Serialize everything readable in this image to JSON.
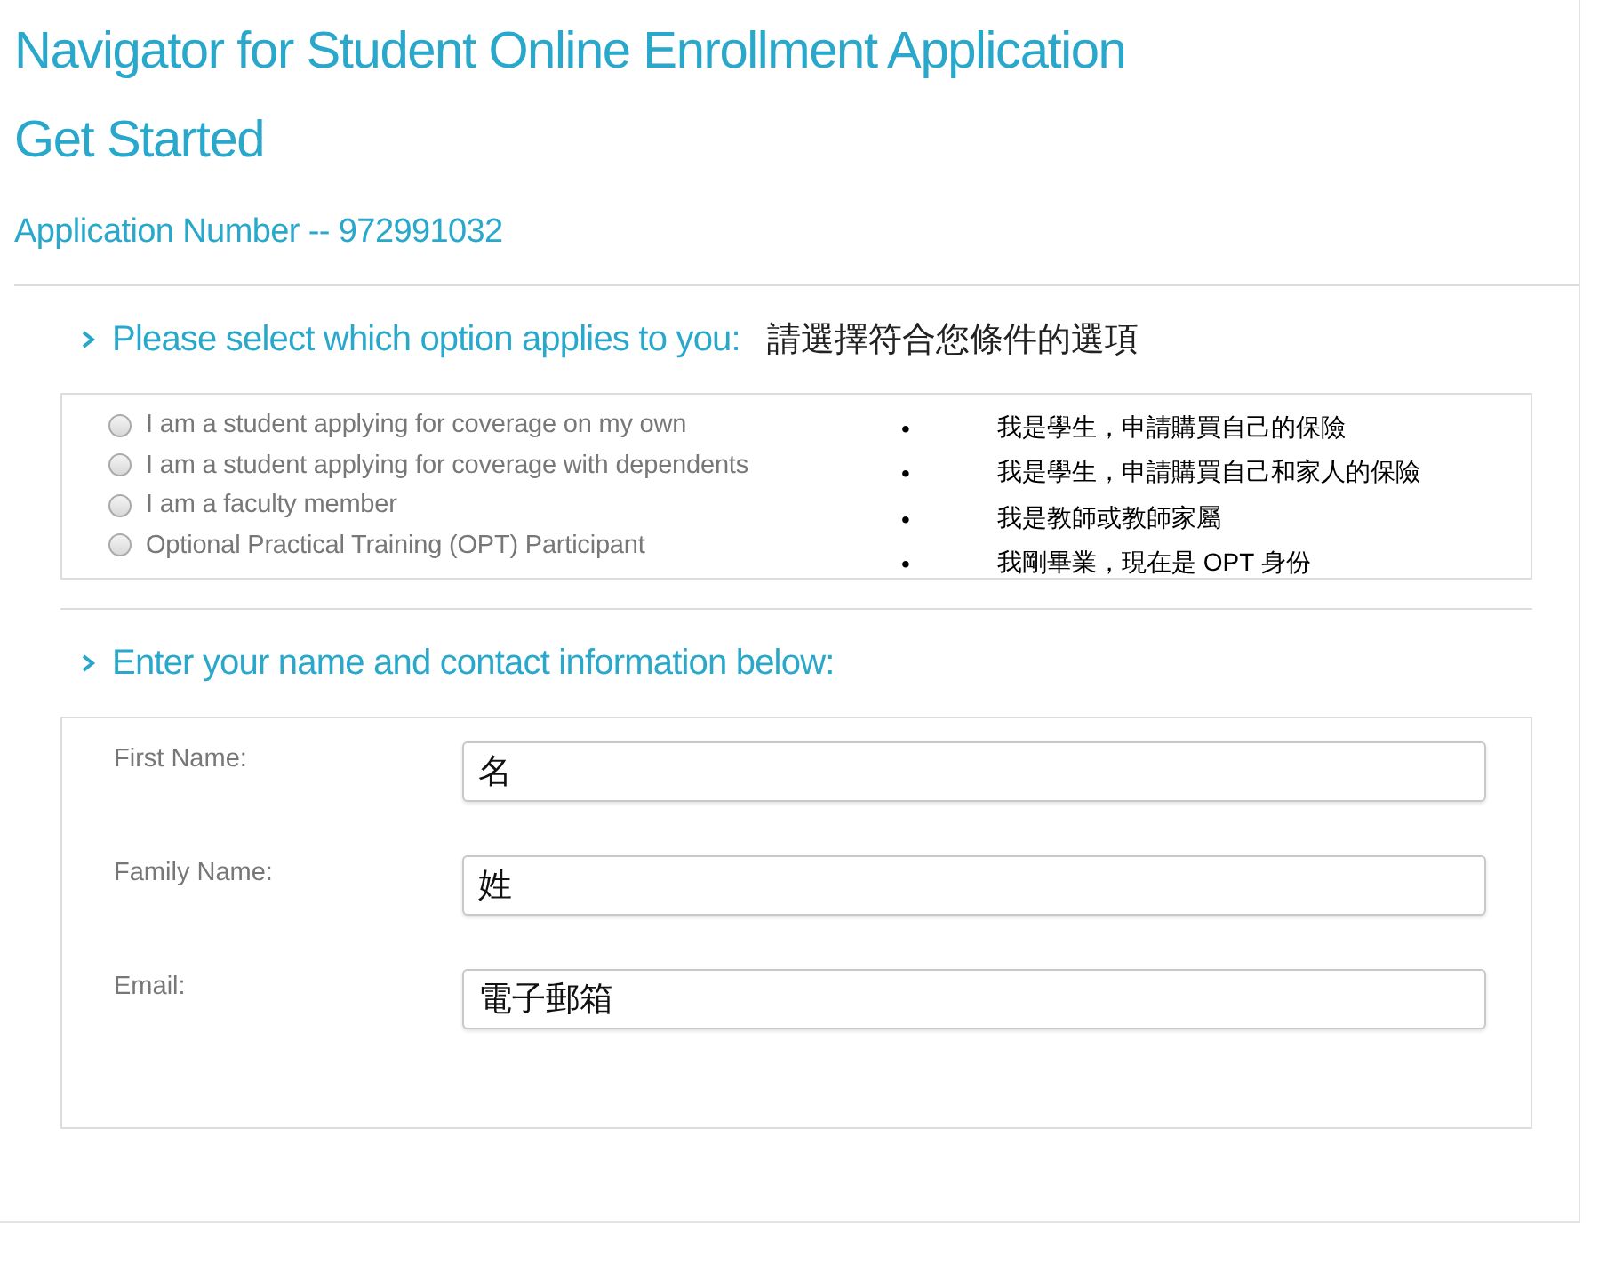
{
  "title_lines": [
    "Navigator for Student Online Enrollment Application",
    "Get Started"
  ],
  "application_number": "Application Number -- 972991032",
  "option_section": {
    "heading": "Please select which option applies to you:",
    "heading_translation": "請選擇符合您條件的選項",
    "options": [
      {
        "label": "I am a student applying for coverage on my own",
        "selected": false,
        "bullet": "•",
        "translation": "我是學生，申請購買自己的保險"
      },
      {
        "label": "I am a student applying for coverage with dependents",
        "selected": false,
        "bullet": "•",
        "translation": "我是學生，申請購買自己和家人的保險"
      },
      {
        "label": "I am a faculty member",
        "selected": false,
        "bullet": "•",
        "translation": "我是教師或教師家屬"
      },
      {
        "label": "Optional Practical Training (OPT) Participant",
        "selected": false,
        "bullet": "•",
        "translation": "我剛畢業，現在是 OPT 身份"
      }
    ]
  },
  "contact_section": {
    "heading": "Enter your name and contact information below:",
    "fields": [
      {
        "label": "First Name:",
        "value": "名"
      },
      {
        "label": "Family Name:",
        "value": "姓"
      },
      {
        "label": "Email:",
        "value": "電子郵箱"
      }
    ]
  }
}
